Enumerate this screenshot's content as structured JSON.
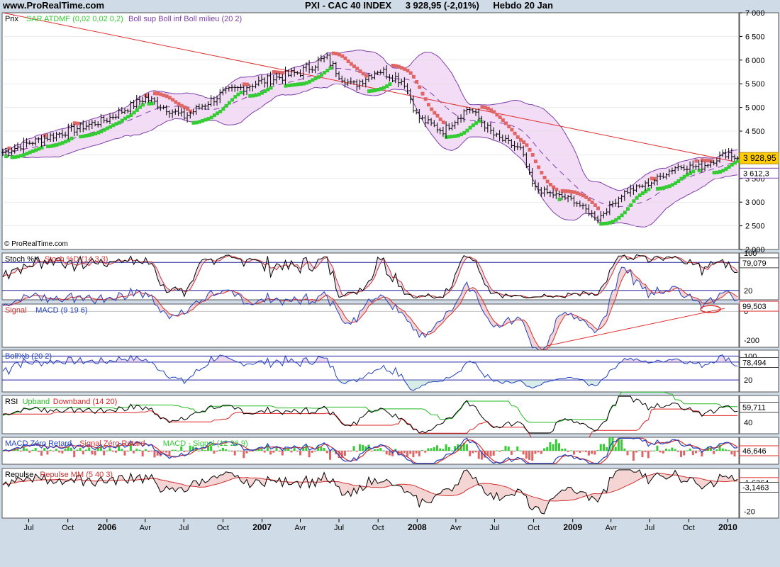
{
  "header": {
    "site": "www.ProRealTime.com",
    "instrument": "PXI - CAC 40 INDEX",
    "last": "3 928,95 (-2,01%)",
    "period": "Hebdo  20 Jan"
  },
  "colors": {
    "background": "#cfdbe6",
    "panel": "#ffffff",
    "price_bar": "#000000",
    "sar_up": "#33cc33",
    "sar_down": "#e06666",
    "bollinger": "#7b3fa8",
    "bollinger_fill": "#f3dcf5",
    "trendline": "#e03030",
    "stoch_k": "#000000",
    "stoch_d": "#cc3333",
    "macd_signal": "#d03030",
    "macd_line": "#2040c0",
    "boll_pctb": "#2040c0",
    "rsi": "#000000",
    "rsi_up": "#22bb22",
    "rsi_down": "#dd2222",
    "last_price_box": "#ffcc00",
    "zero_lag_hist": "#33cc33"
  },
  "chart_data": [
    {
      "id": "price",
      "type": "ohlc",
      "legend": [
        "Prix",
        "SAR ATDMF (0,02 0,02 0,2)",
        "Boll sup Boll inf Boll milieu (20 2)"
      ],
      "watermark": "© ProRealTime.com",
      "yticks": [
        "7 000",
        "6 500",
        "6 000",
        "5 500",
        "5 000",
        "4 500",
        "4 000",
        "3 500",
        "3 000",
        "2 500",
        "2 000"
      ],
      "ylim": [
        2000,
        7000
      ],
      "last_value": "3 928,95",
      "second_value": "3 612,3",
      "xticks": [
        "Jul",
        "Oct",
        "2006",
        "Avr",
        "Jul",
        "Oct",
        "2007",
        "Avr",
        "Jul",
        "Oct",
        "2008",
        "Avr",
        "Jul",
        "Oct",
        "2009",
        "Avr",
        "Jul",
        "Oct",
        "2010"
      ],
      "dates": [
        "2005-05",
        "2005-07",
        "2005-10",
        "2006-01",
        "2006-04",
        "2006-07",
        "2006-10",
        "2007-01",
        "2007-04",
        "2007-06",
        "2007-07",
        "2007-08",
        "2007-10",
        "2007-12",
        "2008-01",
        "2008-03",
        "2008-05",
        "2008-07",
        "2008-09",
        "2008-10",
        "2008-11",
        "2009-01",
        "2009-03",
        "2009-05",
        "2009-07",
        "2009-09",
        "2009-11",
        "2010-01",
        "2010-01-20"
      ],
      "close": [
        4050,
        4250,
        4500,
        4750,
        5200,
        4800,
        5300,
        5550,
        5750,
        6050,
        5700,
        5450,
        5800,
        5550,
        4800,
        4500,
        5000,
        4400,
        4100,
        3300,
        3200,
        3050,
        2650,
        3200,
        3400,
        3750,
        3750,
        4050,
        3929
      ],
      "trendline": {
        "from": [
          "2005-05",
          7000
        ],
        "to": [
          "2010-01-20",
          3850
        ]
      }
    },
    {
      "id": "stoch",
      "type": "line",
      "legend": [
        "Stoch %K",
        "Stoch %D (14 3 3)"
      ],
      "yticks": [
        "100",
        "20"
      ],
      "ylim": [
        0,
        100
      ],
      "last_value": "79,079",
      "levels": [
        80,
        20
      ]
    },
    {
      "id": "macd",
      "type": "line",
      "legend": [
        "Signal",
        "MACD (9 19 6)"
      ],
      "yticks": [
        "0",
        "-200"
      ],
      "ylim": [
        -250,
        50
      ],
      "last_value": "99,503"
    },
    {
      "id": "bollpctb",
      "type": "line",
      "legend": [
        "Boll%b (20 2)"
      ],
      "yticks": [
        "100",
        "20"
      ],
      "ylim": [
        -20,
        120
      ],
      "last_value": "78,494",
      "levels": [
        100,
        80,
        20
      ]
    },
    {
      "id": "rsi",
      "type": "line",
      "legend": [
        "RSI",
        "Upband",
        "Downband (14 20)"
      ],
      "yticks": [
        "40"
      ],
      "ylim": [
        25,
        75
      ],
      "last_value": "59,711"
    },
    {
      "id": "macdzl",
      "type": "line",
      "legend": [
        "MACD Zéro Retard",
        "Signal Zéro Retard",
        "MACD - Signal (12 26 9)"
      ],
      "yticks": [],
      "ylim": [
        -150,
        150
      ],
      "last_value": "46,646"
    },
    {
      "id": "repulse",
      "type": "line",
      "legend": [
        "Repulse",
        "Repulse MM (5 40 3)"
      ],
      "yticks": [
        "-20"
      ],
      "ylim": [
        -25,
        12
      ],
      "last_value": "-3,1463",
      "second_value": "-1,6364"
    }
  ]
}
